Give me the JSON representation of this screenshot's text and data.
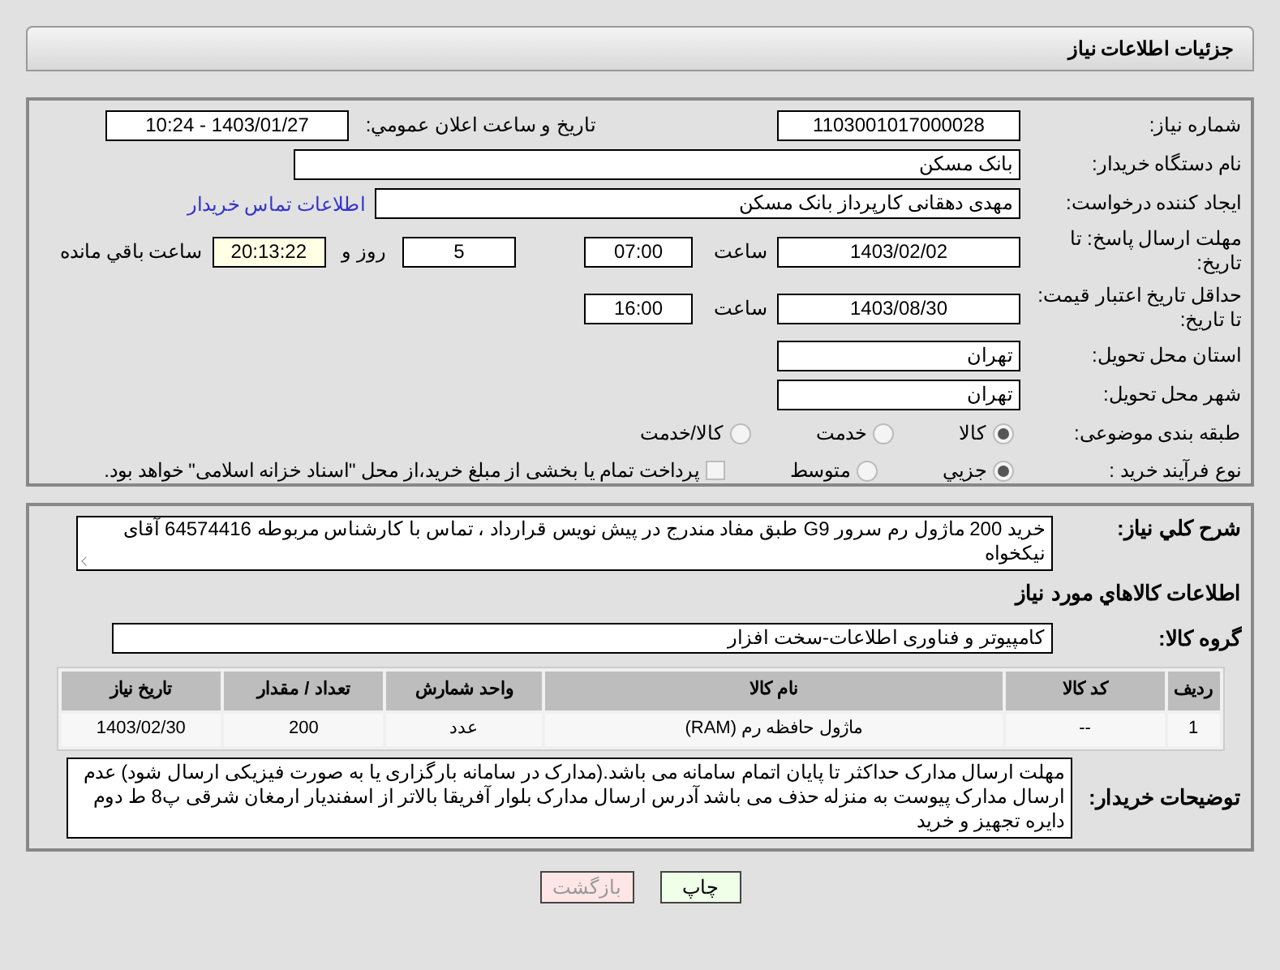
{
  "header": {
    "title": "جزئیات اطلاعات نیاز"
  },
  "need_number": {
    "label": "شماره نیاز:",
    "value": "1103001017000028"
  },
  "announce": {
    "label": "تاریخ و ساعت اعلان عمومي:",
    "value": "1403/01/27 - 10:24"
  },
  "buyer_org": {
    "label": "نام دستگاه خریدار:",
    "value": "بانک مسکن"
  },
  "creator": {
    "label": "ایجاد کننده درخواست:",
    "value": "مهدی دهقانی کارپرداز بانک مسکن",
    "link": "اطلاعات تماس خریدار"
  },
  "reply_deadline": {
    "label": "مهلت ارسال پاسخ: تا تاریخ:",
    "date": "1403/02/02",
    "time_label": "ساعت",
    "time": "07:00",
    "days": "5",
    "days_label": "روز و",
    "remaining": "20:13:22",
    "remaining_label": "ساعت باقي مانده"
  },
  "price_validity": {
    "label": "حداقل تاریخ اعتبار قیمت: تا تاریخ:",
    "date": "1403/08/30",
    "time_label": "ساعت",
    "time": "16:00"
  },
  "province": {
    "label": "استان محل تحویل:",
    "value": "تهران"
  },
  "city": {
    "label": "شهر محل تحویل:",
    "value": "تهران"
  },
  "category": {
    "label": "طبقه بندی موضوعی:",
    "options": [
      {
        "label": "کالا",
        "selected": true
      },
      {
        "label": "خدمت",
        "selected": false
      },
      {
        "label": "کالا/خدمت",
        "selected": false
      }
    ]
  },
  "purchase_type": {
    "label": "نوع فرآیند خرید :",
    "options": [
      {
        "label": "جزیي",
        "selected": true
      },
      {
        "label": "متوسط",
        "selected": false
      }
    ],
    "payment": {
      "label": "پرداخت تمام یا بخشی از مبلغ خرید،از محل \"اسناد خزانه اسلامی\" خواهد بود.",
      "checked": false
    }
  },
  "description": {
    "label": "شرح کلي نیاز:",
    "value": "خرید 200 ماژول رم سرور G9 طبق مفاد مندرج در پیش نویس قرارداد ، تماس با کارشناس مربوطه 64574416 آقای نیکخواه"
  },
  "goods_heading": "اطلاعات کالاهاي مورد نیاز",
  "goods_group": {
    "label": "گروه کالا:",
    "value": "کامپیوتر و فناوری اطلاعات-سخت افزار"
  },
  "table": {
    "columns": [
      "ردیف",
      "کد کالا",
      "نام کالا",
      "واحد شمارش",
      "تعداد / مقدار",
      "تاریخ نیاز"
    ],
    "rows": [
      [
        "1",
        "--",
        "ماژول حافظه رم (RAM)",
        "عدد",
        "200",
        "1403/02/30"
      ]
    ]
  },
  "buyer_notes": {
    "label": "توضیحات خریدار:",
    "value": "مهلت ارسال مدارک حداکثر تا پایان اتمام سامانه می باشد.(مدارک در سامانه بارگزاری یا به صورت فیزیکی ارسال شود) عدم ارسال مدارک پیوست به منزله حذف می باشد آدرس ارسال مدارک بلوار آفریقا بالاتر از اسفندیار ارمغان شرقی پ8 ط دوم دایره تجهیز و خرید"
  },
  "buttons": [
    {
      "label": "چاپ",
      "kind": "print"
    },
    {
      "label": "بازگشت",
      "kind": "back"
    }
  ]
}
